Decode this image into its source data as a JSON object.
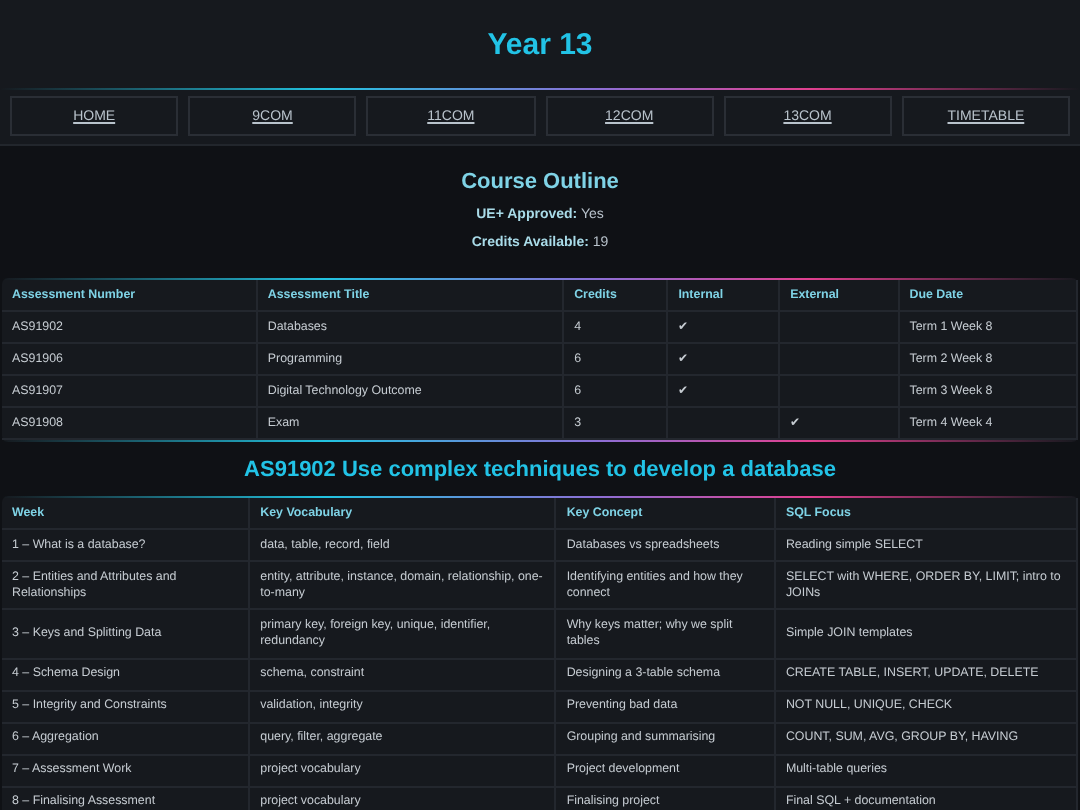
{
  "title": "Year 13",
  "nav": [
    {
      "label": "HOME"
    },
    {
      "label": "9COM"
    },
    {
      "label": "11COM"
    },
    {
      "label": "12COM"
    },
    {
      "label": "13COM"
    },
    {
      "label": "TIMETABLE"
    }
  ],
  "outline": {
    "heading": "Course Outline",
    "facts": [
      {
        "label": "UE+ Approved:",
        "value": "Yes"
      },
      {
        "label": "Credits Available:",
        "value": "19"
      }
    ]
  },
  "assessments": {
    "columns": [
      "Assessment Number",
      "Assessment Title",
      "Credits",
      "Internal",
      "External",
      "Due Date"
    ],
    "rows": [
      [
        "AS91902",
        "Databases",
        "4",
        "✔",
        "",
        "Term 1 Week 8"
      ],
      [
        "AS91906",
        "Programming",
        "6",
        "✔",
        "",
        "Term 2 Week 8"
      ],
      [
        "AS91907",
        "Digital Technology Outcome",
        "6",
        "✔",
        "",
        "Term 3 Week 8"
      ],
      [
        "AS91908",
        "Exam",
        "3",
        "",
        "✔",
        "Term 4 Week 4"
      ]
    ]
  },
  "standard": {
    "heading": "AS91902 Use complex techniques to develop a database",
    "columns": [
      "Week",
      "Key Vocabulary",
      "Key Concept",
      "SQL Focus"
    ],
    "rows": [
      [
        "1 – What is a database?",
        "data, table, record, field",
        "Databases vs spreadsheets",
        "Reading simple SELECT"
      ],
      [
        "2 – Entities and Attributes and Relationships",
        "entity, attribute, instance, domain, relationship, one-to-many",
        "Identifying entities and how they connect",
        "SELECT with WHERE, ORDER BY, LIMIT; intro to JOINs"
      ],
      [
        "3 – Keys and Splitting Data",
        "primary key, foreign key, unique, identifier, redundancy",
        "Why keys matter; why we split tables",
        "Simple JOIN templates"
      ],
      [
        "4 – Schema Design",
        "schema, constraint",
        "Designing a 3-table schema",
        "CREATE TABLE, INSERT, UPDATE, DELETE"
      ],
      [
        "5 – Integrity and Constraints",
        "validation, integrity",
        "Preventing bad data",
        "NOT NULL, UNIQUE, CHECK"
      ],
      [
        "6 – Aggregation",
        "query, filter, aggregate",
        "Grouping and summarising",
        "COUNT, SUM, AVG, GROUP BY, HAVING"
      ],
      [
        "7 – Assessment Work",
        "project vocabulary",
        "Project development",
        "Multi-table queries"
      ],
      [
        "8 – Finalising Assessment",
        "project vocabulary",
        "Finalising project",
        "Final SQL + documentation"
      ]
    ]
  }
}
